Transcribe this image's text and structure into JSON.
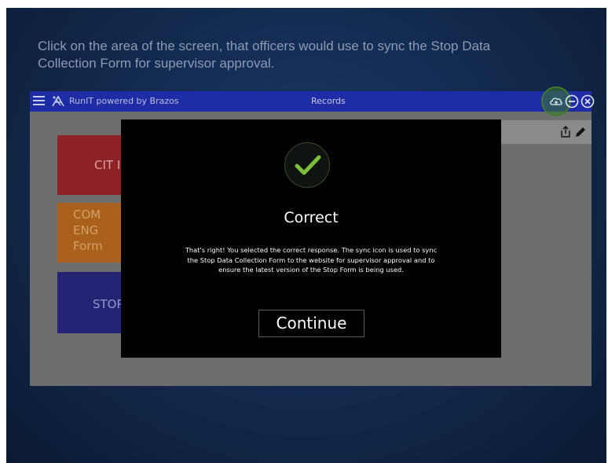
{
  "instruction": {
    "line1": "Click on the area of the screen, that officers would use to sync the Stop Data",
    "line2": "Collection Form for supervisor approval."
  },
  "app": {
    "brand": "RunIT powered by Brazos",
    "title": "Records",
    "icons": {
      "menu": "hamburger-menu-icon",
      "logo": "brazos-logo-icon",
      "sync": "cloud-sync-icon",
      "minimize": "minus-circle-icon",
      "close": "close-circle-icon",
      "export": "export-icon",
      "edit": "pencil-icon"
    },
    "tiles": {
      "cit": "CIT I",
      "com": [
        "COM",
        "ENG",
        "Form"
      ],
      "stop": "STOP"
    },
    "colors": {
      "titlebar": "#1e2ca6",
      "cit": "#8e2226",
      "com": "#a9611c",
      "stop": "#252474",
      "highlight": "#3f7a30"
    }
  },
  "modal": {
    "icon": "checkmark-icon",
    "title": "Correct",
    "body_line1": "That's right!  You selected the correct response. The sync icon is used to sync",
    "body_line2": "the Stop Data Collection Form to the website for supervisor approval and to",
    "body_line3": "ensure the latest version of the Stop Form is being used.",
    "button": "Continue",
    "check_color": "#7bbf3a"
  }
}
